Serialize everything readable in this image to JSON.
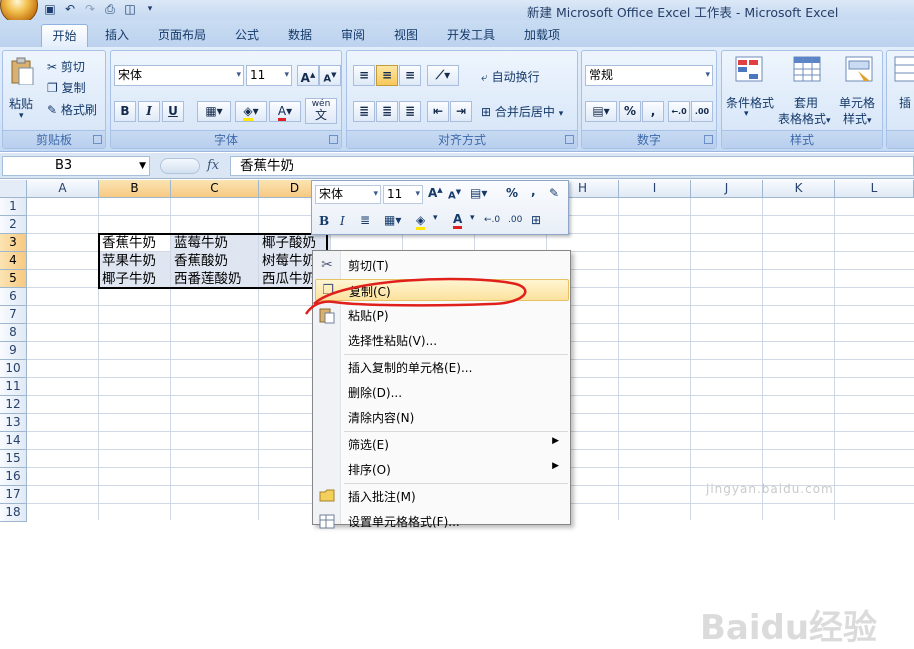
{
  "window": {
    "title": "新建 Microsoft Office Excel 工作表 - Microsoft Excel",
    "qat_icons": [
      "save-icon",
      "undo-icon",
      "redo-icon",
      "print-icon",
      "print-preview-icon",
      "customize-qat-icon"
    ]
  },
  "tabs": [
    "开始",
    "插入",
    "页面布局",
    "公式",
    "数据",
    "审阅",
    "视图",
    "开发工具",
    "加载项"
  ],
  "active_tab": "开始",
  "ribbon": {
    "clipboard": {
      "label": "剪贴板",
      "paste": "粘贴",
      "cut": "剪切",
      "copy": "复制",
      "format_painter": "格式刷"
    },
    "font": {
      "label": "字体",
      "name": "宋体",
      "size": "11",
      "bold": "B",
      "italic": "I",
      "underline": "U",
      "grow": "A",
      "shrink": "A",
      "wen": "wén",
      "wen_char": "文"
    },
    "alignment": {
      "label": "对齐方式",
      "wrap": "自动换行",
      "merge": "合并后居中"
    },
    "number": {
      "label": "数字",
      "format": "常规",
      "percent": "%",
      "comma": ","
    },
    "styles": {
      "label": "样式",
      "conditional": "条件格式",
      "table_format": "套用",
      "table_format2": "表格格式",
      "cell_styles": "单元格",
      "cell_styles2": "样式"
    },
    "cells": {
      "insert": "插"
    }
  },
  "formula_bar": {
    "name_box": "B3",
    "fx": "fx",
    "value": "香蕉牛奶"
  },
  "columns": [
    "A",
    "B",
    "C",
    "D",
    "E",
    "F",
    "G",
    "H",
    "I",
    "J",
    "K",
    "L"
  ],
  "rows": [
    "1",
    "2",
    "3",
    "4",
    "5",
    "6",
    "7",
    "8",
    "9",
    "10",
    "11",
    "12",
    "13",
    "14",
    "15",
    "16",
    "17",
    "18"
  ],
  "cells": {
    "B3": "香蕉牛奶",
    "C3": "蓝莓牛奶",
    "D3": "椰子酸奶",
    "B4": "苹果牛奶",
    "C4": "香蕉酸奶",
    "D4": "树莓牛奶",
    "B5": "椰子牛奶",
    "C5": "西番莲酸奶",
    "D5": "西瓜牛奶"
  },
  "mini_toolbar": {
    "font": "宋体",
    "size": "11",
    "bold": "B",
    "italic": "I",
    "percent": "%",
    "comma": ","
  },
  "context_menu": [
    {
      "label": "剪切(T)",
      "icon": "scissors-icon"
    },
    {
      "label": "复制(C)",
      "icon": "copy-icon",
      "highlighted": true
    },
    {
      "label": "粘贴(P)",
      "icon": "paste-icon"
    },
    {
      "label": "选择性粘贴(V)..."
    },
    {
      "label": "插入复制的单元格(E)..."
    },
    {
      "label": "删除(D)..."
    },
    {
      "label": "清除内容(N)"
    },
    {
      "label": "筛选(E)",
      "submenu": true
    },
    {
      "label": "排序(O)",
      "submenu": true
    },
    {
      "label": "插入批注(M)",
      "icon": "comment-icon"
    },
    {
      "label": "设置单元格格式(F)...",
      "icon": "format-cells-icon"
    }
  ],
  "watermark": {
    "text": "Baidu经验",
    "url": "jingyan.baidu.com"
  },
  "colors": {
    "accent": "#f8c85a",
    "ribbon": "#d6e5f7",
    "annotation": "#e0201a"
  }
}
